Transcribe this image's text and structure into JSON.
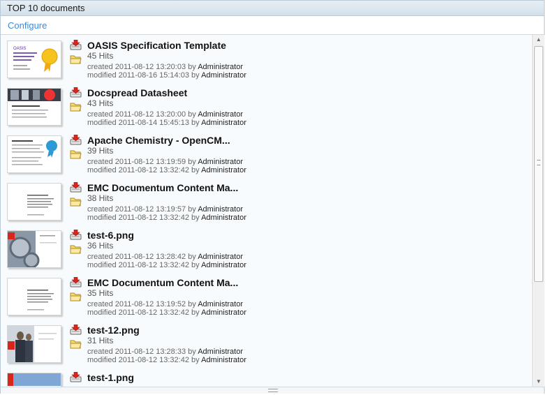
{
  "panel": {
    "title": "TOP 10 documents",
    "configure_label": "Configure"
  },
  "documents": [
    {
      "title": "OASIS Specification Template",
      "hits": "45 Hits",
      "created_prefix": "created 2011-08-12 13:20:03 by",
      "created_by": "Administrator",
      "modified_prefix": "modified 2011-08-16 15:14:03 by",
      "modified_by": "Administrator",
      "thumb": "oasis",
      "thumb_text": "OASIS"
    },
    {
      "title": "Docspread Datasheet",
      "hits": "43 Hits",
      "created_prefix": "created 2011-08-12 13:20:00 by",
      "created_by": "Administrator",
      "modified_prefix": "modified 2011-08-14 15:45:13 by",
      "modified_by": "Administrator",
      "thumb": "docspread"
    },
    {
      "title": "Apache Chemistry - OpenCM...",
      "hits": "39 Hits",
      "created_prefix": "created 2011-08-12 13:19:59 by",
      "created_by": "Administrator",
      "modified_prefix": "modified 2011-08-12 13:32:42 by",
      "modified_by": "Administrator",
      "thumb": "apache"
    },
    {
      "title": "EMC Documentum Content Ma...",
      "hits": "38 Hits",
      "created_prefix": "created 2011-08-12 13:19:57 by",
      "created_by": "Administrator",
      "modified_prefix": "modified 2011-08-12 13:32:42 by",
      "modified_by": "Administrator",
      "thumb": "emc"
    },
    {
      "title": "test-6.png",
      "hits": "36 Hits",
      "created_prefix": "created 2011-08-12 13:28:42 by",
      "created_by": "Administrator",
      "modified_prefix": "modified 2011-08-12 13:32:42 by",
      "modified_by": "Administrator",
      "thumb": "gears"
    },
    {
      "title": "EMC Documentum Content Ma...",
      "hits": "35 Hits",
      "created_prefix": "created 2011-08-12 13:19:52 by",
      "created_by": "Administrator",
      "modified_prefix": "modified 2011-08-12 13:32:42 by",
      "modified_by": "Administrator",
      "thumb": "emc"
    },
    {
      "title": "test-12.png",
      "hits": "31 Hits",
      "created_prefix": "created 2011-08-12 13:28:33 by",
      "created_by": "Administrator",
      "modified_prefix": "modified 2011-08-12 13:32:42 by",
      "modified_by": "Administrator",
      "thumb": "people"
    },
    {
      "title": "test-1.png",
      "hits": "",
      "created_prefix": "",
      "created_by": "",
      "modified_prefix": "",
      "modified_by": "",
      "thumb": "blue"
    }
  ],
  "colors": {
    "accent": "#3d8ad6",
    "download_red": "#d9261c",
    "folder_yellow": "#f4d35e"
  },
  "icons": {
    "download": "download-icon",
    "folder": "folder-icon"
  }
}
